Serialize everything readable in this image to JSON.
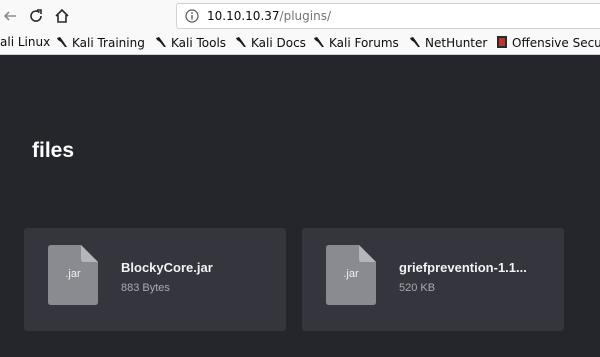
{
  "browser": {
    "url_host": "10.10.10.37",
    "url_path": "/plugins/",
    "bookmarks": [
      "ali Linux",
      "Kali Training",
      "Kali Tools",
      "Kali Docs",
      "Kali Forums",
      "NetHunter",
      "Offensive Secur"
    ]
  },
  "page": {
    "heading": "files",
    "files": [
      {
        "ext": ".jar",
        "name": "BlockyCore.jar",
        "size": "883 Bytes"
      },
      {
        "ext": ".jar",
        "name": "griefprevention-1.1...",
        "size": "520 KB"
      }
    ]
  },
  "colors": {
    "background": "#25262b",
    "card": "#34353d",
    "file_icon": "#8a8b90"
  }
}
